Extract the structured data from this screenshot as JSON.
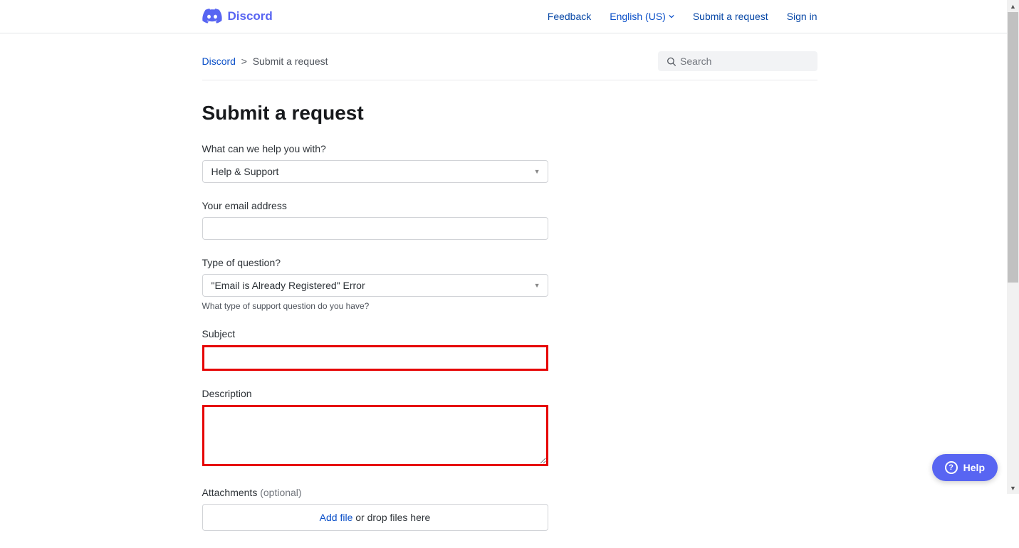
{
  "header": {
    "logo_text": "Discord",
    "nav": {
      "feedback": "Feedback",
      "language": "English (US)",
      "submit_request": "Submit a request",
      "sign_in": "Sign in"
    }
  },
  "breadcrumb": {
    "home": "Discord",
    "separator": ">",
    "current": "Submit a request"
  },
  "search": {
    "placeholder": "Search"
  },
  "page": {
    "title": "Submit a request"
  },
  "form": {
    "help_with": {
      "label": "What can we help you with?",
      "value": "Help & Support"
    },
    "email": {
      "label": "Your email address",
      "value": ""
    },
    "question_type": {
      "label": "Type of question?",
      "value": "\"Email is Already Registered\" Error",
      "helper": "What type of support question do you have?"
    },
    "subject": {
      "label": "Subject",
      "value": ""
    },
    "description": {
      "label": "Description",
      "value": ""
    },
    "attachments": {
      "label": "Attachments",
      "optional": "(optional)",
      "add_file": "Add file",
      "drop_text": " or drop files here"
    }
  },
  "help_widget": {
    "label": "Help"
  }
}
